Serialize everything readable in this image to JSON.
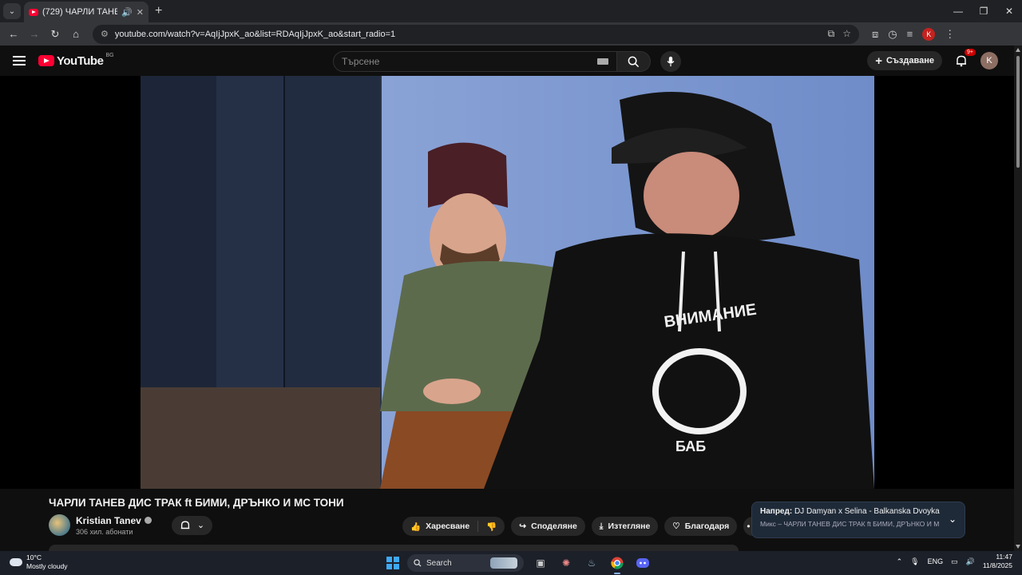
{
  "browser": {
    "tab_title": "(729) ЧАРЛИ ТАНЕВ ДИС ТРАК ft БИМИ, ДРЪНКО И МС ТОНИ",
    "url": "youtube.com/watch?v=AqIjJpxK_ao&list=RDAqIjJpxK_ao&start_radio=1",
    "profile_initial": "K"
  },
  "youtube": {
    "logo_text": "YouTube",
    "region": "BG",
    "search_placeholder": "Търсене",
    "create_label": "Създаване",
    "notifications_badge": "9+",
    "avatar_initial": "K"
  },
  "video": {
    "title": "ЧАРЛИ ТАНЕВ ДИС ТРАК ft БИМИ, ДРЪНКО И МС ТОНИ",
    "channel_name": "Kristian Tanev",
    "subscribers": "306 хил. абонати",
    "hoodie_text_top": "ВНИМАНИЕ",
    "hoodie_text_bottom": "БАБ"
  },
  "actions": {
    "like": "Харесване",
    "share": "Споделяне",
    "download": "Изтегляне",
    "thanks": "Благодаря"
  },
  "up_next": {
    "label": "Напред:",
    "title": "DJ Damyan x Selina - Balkanska Dvoyka / ...",
    "subtitle": "Микс – ЧАРЛИ ТАНЕВ ДИС ТРАК ft БИМИ, ДРЪНКО И М..."
  },
  "taskbar": {
    "temperature": "10°C",
    "weather": "Mostly cloudy",
    "search_label": "Search",
    "language": "ENG",
    "time": "11:47",
    "date": "11/8/2025"
  },
  "colors": {
    "yt_red": "#ff0033",
    "page_bg": "#0f0f0f",
    "chip_bg": "#272727"
  }
}
